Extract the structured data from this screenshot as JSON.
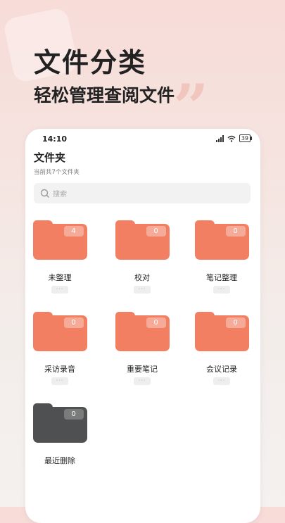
{
  "promo": {
    "headline": "文件分类",
    "subline": "轻松管理查阅文件",
    "quote_mark": "”"
  },
  "status_bar": {
    "time": "14:10",
    "battery": "39"
  },
  "header": {
    "title": "文件夹",
    "subtitle": "当前共7个文件夹"
  },
  "search": {
    "placeholder": "搜索"
  },
  "folders": [
    {
      "label": "未整理",
      "count": "4",
      "color": "#f27f62",
      "more": "···"
    },
    {
      "label": "校对",
      "count": "0",
      "color": "#f27f62",
      "more": "···"
    },
    {
      "label": "笔记整理",
      "count": "0",
      "color": "#f27f62",
      "more": "···"
    },
    {
      "label": "采访录音",
      "count": "0",
      "color": "#f27f62",
      "more": "···"
    },
    {
      "label": "重要笔记",
      "count": "0",
      "color": "#f27f62",
      "more": "···"
    },
    {
      "label": "会议记录",
      "count": "0",
      "color": "#f27f62",
      "more": "···"
    },
    {
      "label": "最近删除",
      "count": "0",
      "color": "#4e5051"
    }
  ]
}
